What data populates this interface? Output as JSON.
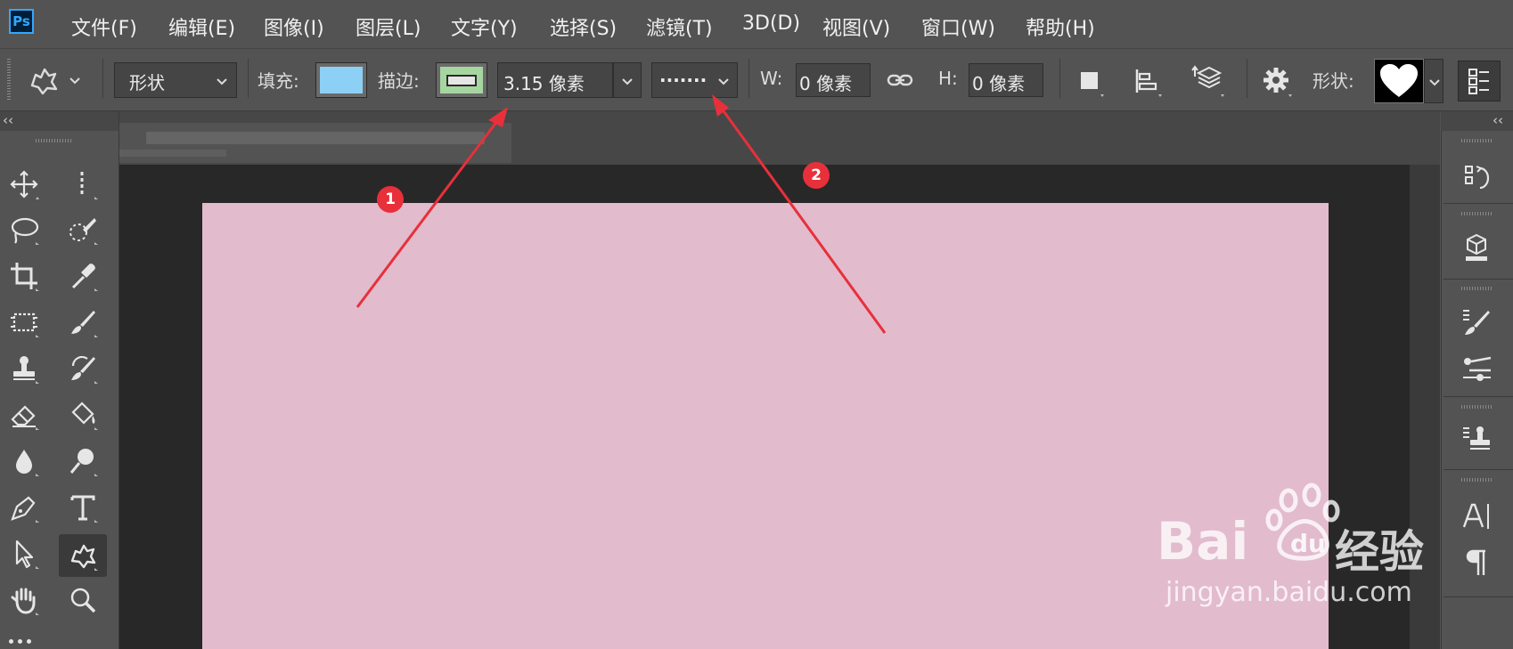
{
  "app": {
    "logo_text": "Ps"
  },
  "menu": [
    "文件(F)",
    "编辑(E)",
    "图像(I)",
    "图层(L)",
    "文字(Y)",
    "选择(S)",
    "滤镜(T)",
    "3D(D)",
    "视图(V)",
    "窗口(W)",
    "帮助(H)"
  ],
  "options": {
    "mode_value": "形状",
    "fill_label": "填充:",
    "fill_color": "#8dd0f5",
    "stroke_label": "描边:",
    "stroke_color": "#a6d6a0",
    "stroke_width": "3.15 像素",
    "stroke_style": ".......",
    "w_label": "W:",
    "w_value": "0 像素",
    "h_label": "H:",
    "h_value": "0 像素",
    "shape_label": "形状:",
    "shape_icon": "heart-icon"
  },
  "panels": {
    "collapse_left": "‹‹",
    "collapse_right": "‹‹"
  },
  "canvas": {
    "color": "#e2bbcd"
  },
  "annotations": {
    "badge1": "1",
    "badge2": "2",
    "arrow_color": "#e8303a"
  },
  "watermark": {
    "brand": "Bai",
    "brand2": "du",
    "cn": "经验",
    "url": "jingyan.baidu.com"
  }
}
